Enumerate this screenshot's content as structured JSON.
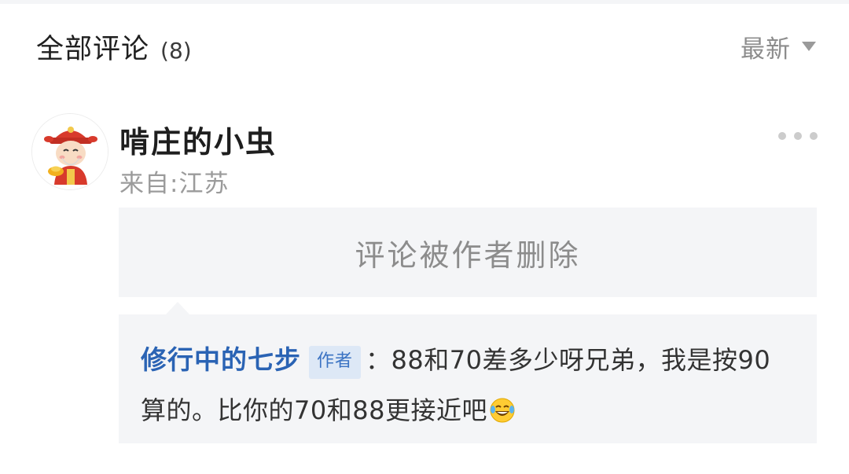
{
  "header": {
    "title": "全部评论",
    "count": "(8)",
    "sort_label": "最新"
  },
  "comment": {
    "user_name": "啃庄的小虫",
    "location": "来自:江苏",
    "deleted_text": "评论被作者删除",
    "reply": {
      "author": "修行中的七步",
      "badge": "作者",
      "text": "：88和70差多少呀兄弟，我是按90算的。比你的70和88更接近吧",
      "emoji": "laughing-tears-emoji"
    }
  },
  "colors": {
    "link_blue": "#2a63b4",
    "badge_bg": "#dde8f6",
    "panel_bg": "#f4f5f7",
    "muted_text": "#8c8c8c"
  }
}
